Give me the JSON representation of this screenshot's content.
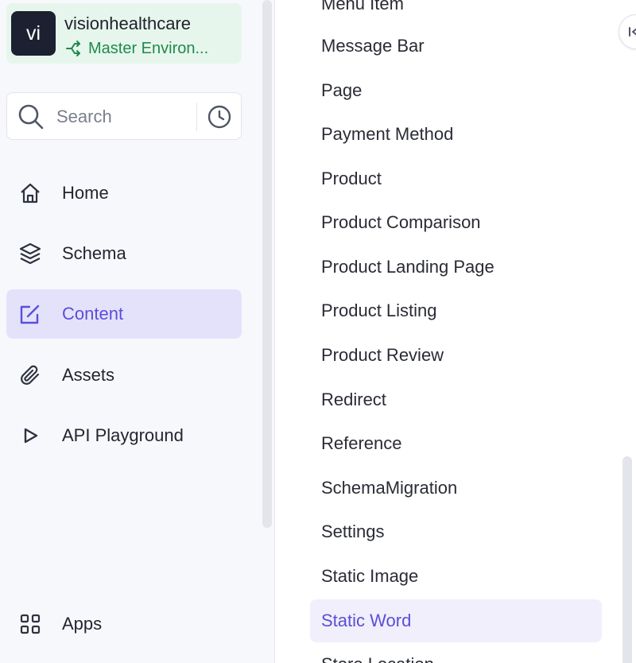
{
  "project": {
    "avatar_initials": "vi",
    "name": "visionhealthcare",
    "environment": "Master Environ..."
  },
  "search": {
    "placeholder": "Search"
  },
  "nav": {
    "items": [
      {
        "label": "Home",
        "icon": "home-icon"
      },
      {
        "label": "Schema",
        "icon": "layers-icon"
      },
      {
        "label": "Content",
        "icon": "edit-icon",
        "active": true
      },
      {
        "label": "Assets",
        "icon": "paperclip-icon"
      },
      {
        "label": "API Playground",
        "icon": "play-icon"
      }
    ],
    "apps_label": "Apps"
  },
  "models": {
    "items": [
      "Menu Item",
      "Message Bar",
      "Page",
      "Payment Method",
      "Product",
      "Product Comparison",
      "Product Landing Page",
      "Product Listing",
      "Product Review",
      "Redirect",
      "Reference",
      "SchemaMigration",
      "Settings",
      "Static Image",
      "Static Word",
      "Store Location"
    ],
    "active": "Static Word"
  },
  "colors": {
    "accent": "#5b4ed8",
    "active_bg": "#e4e2fb",
    "project_bg": "#e7f6ec",
    "env_text": "#1f8a4c"
  }
}
